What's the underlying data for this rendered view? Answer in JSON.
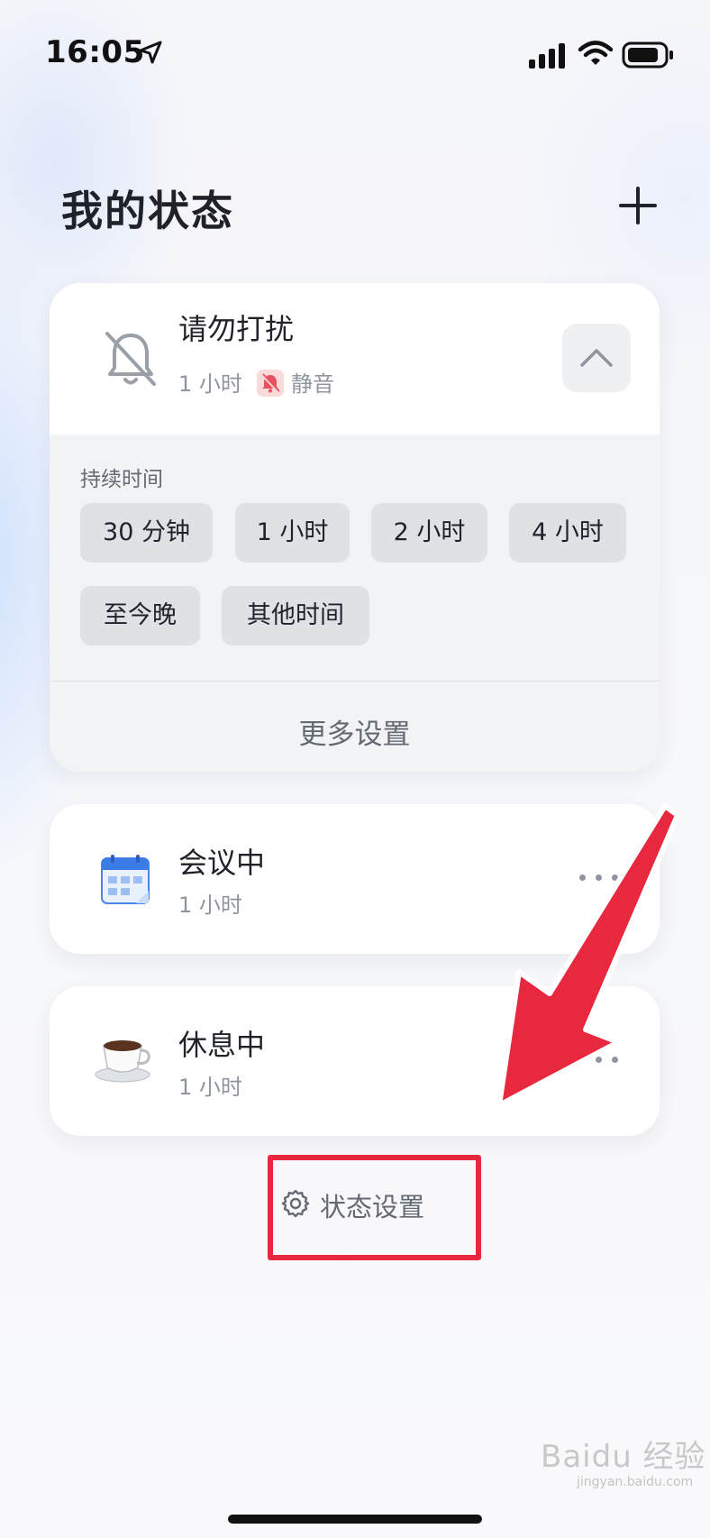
{
  "status_bar": {
    "time": "16:05"
  },
  "header": {
    "title": "我的状态"
  },
  "dnd": {
    "title": "请勿打扰",
    "duration": "1 小时",
    "mode": "静音",
    "duration_label": "持续时间",
    "chips": [
      "30 分钟",
      "1 小时",
      "2 小时",
      "4 小时",
      "至今晚",
      "其他时间"
    ],
    "more_settings": "更多设置"
  },
  "statuses": [
    {
      "title": "会议中",
      "duration": "1 小时",
      "icon": "calendar-icon"
    },
    {
      "title": "休息中",
      "duration": "1 小时",
      "icon": "coffee-cup-icon"
    }
  ],
  "footer": {
    "status_settings": "状态设置"
  },
  "watermark": {
    "text": "Baidu 经验",
    "url": "jingyan.baidu.com"
  },
  "colors": {
    "highlight": "#e8283f",
    "mute_bg": "#fbdada",
    "muted_text": "#8f959e"
  }
}
